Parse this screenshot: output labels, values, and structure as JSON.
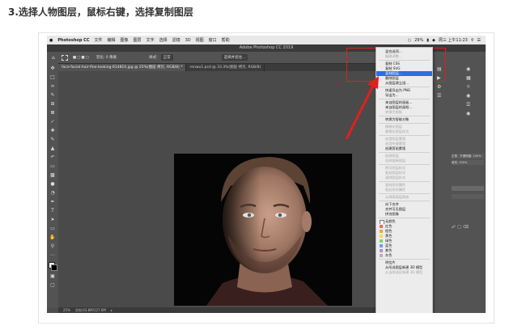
{
  "step_title": "3.选择人物图层，鼠标右键，选择复制图层",
  "mac_menubar": {
    "apple": "",
    "app_name": "Photoshop CC",
    "items": [
      "文件",
      "编辑",
      "图像",
      "图层",
      "文字",
      "选择",
      "滤镜",
      "3D",
      "视图",
      "窗口",
      "帮助"
    ],
    "battery": "29%",
    "date_time": "周三 上午11:23"
  },
  "window_title": "Adobe Photoshop CC 2019",
  "options_bar": {
    "feather": "羽化: 0 像素",
    "style_label": "样式:",
    "style_value": "正常",
    "select_mask": "选择并遮住..."
  },
  "tabs": [
    {
      "label": "face-facial-hair-fine-looking-614810.jpg @ 25%(图层 拷贝, RGB/8) *"
    },
    {
      "label": "renwu1.psd @ 33.3%(图层 拷贝, RGB/8)"
    }
  ],
  "status_bar": {
    "zoom": "25%",
    "doc_size": "文档:63.8M/127.6M"
  },
  "context_menu": {
    "items": [
      {
        "label": "混合选项...",
        "disabled": false
      },
      {
        "label": "编辑调整...",
        "disabled": true
      },
      {
        "sep": true
      },
      {
        "label": "复制 CSS",
        "disabled": false
      },
      {
        "label": "复制 SVG",
        "disabled": false
      },
      {
        "label": "复制图层...",
        "disabled": false,
        "highlight": true
      },
      {
        "label": "删除图层",
        "disabled": false
      },
      {
        "label": "从图层建立组...",
        "disabled": false
      },
      {
        "sep": true
      },
      {
        "label": "快速导出为 PNG",
        "disabled": false
      },
      {
        "label": "导出为...",
        "disabled": false
      },
      {
        "sep": true
      },
      {
        "label": "来自图层的画板...",
        "disabled": false
      },
      {
        "label": "来自图层的画框...",
        "disabled": false
      },
      {
        "label": "转换为图框",
        "disabled": true
      },
      {
        "sep": true
      },
      {
        "label": "转换为智能对象",
        "disabled": false
      },
      {
        "sep": true
      },
      {
        "label": "栅格化图层",
        "disabled": true
      },
      {
        "label": "栅格化图层样式",
        "disabled": true
      },
      {
        "sep": true
      },
      {
        "label": "启用图层蒙版",
        "disabled": true
      },
      {
        "label": "启用矢量蒙版",
        "disabled": true
      },
      {
        "label": "创建剪贴蒙版",
        "disabled": false
      },
      {
        "sep": true
      },
      {
        "label": "链接图层",
        "disabled": true
      },
      {
        "label": "选择链接图层",
        "disabled": true
      },
      {
        "sep": true
      },
      {
        "label": "拷贝图层样式",
        "disabled": true
      },
      {
        "label": "粘贴图层样式",
        "disabled": true
      },
      {
        "label": "清除图层样式",
        "disabled": true
      },
      {
        "sep": true
      },
      {
        "label": "复制形状属性",
        "disabled": true
      },
      {
        "label": "粘贴形状属性",
        "disabled": true
      },
      {
        "sep": true
      },
      {
        "label": "从隔离图层释放",
        "disabled": true
      },
      {
        "sep": true
      },
      {
        "label": "向下合并",
        "disabled": false
      },
      {
        "label": "合并可见图层",
        "disabled": false
      },
      {
        "label": "拼合图像",
        "disabled": false
      },
      {
        "sep": true
      },
      {
        "label": "无颜色",
        "disabled": false,
        "swatch": "#ffffff",
        "swatch_border": true
      },
      {
        "label": "红色",
        "disabled": false,
        "swatch": "#f26b6b"
      },
      {
        "label": "橙色",
        "disabled": false,
        "swatch": "#f7a34b"
      },
      {
        "label": "黄色",
        "disabled": false,
        "swatch": "#f2e04b"
      },
      {
        "label": "绿色",
        "disabled": false,
        "swatch": "#7fd46b"
      },
      {
        "label": "蓝色",
        "disabled": false,
        "swatch": "#6b9ff2"
      },
      {
        "label": "紫色",
        "disabled": false,
        "swatch": "#b98ae0"
      },
      {
        "label": "灰色",
        "disabled": false,
        "swatch": "#b3b3b3"
      },
      {
        "sep": true
      },
      {
        "label": "明信片",
        "disabled": false
      },
      {
        "label": "从所选图层新建 3D 模型",
        "disabled": false
      },
      {
        "label": "从当前选区新建 3D 模型",
        "disabled": true
      }
    ]
  },
  "layers_panel": {
    "blend_mode": "正常",
    "opacity": "不透明度: 100%",
    "fill": "填充: 100%"
  },
  "colors": {
    "highlight_blue": "#2b6fde",
    "callout_red": "#e0201b"
  }
}
